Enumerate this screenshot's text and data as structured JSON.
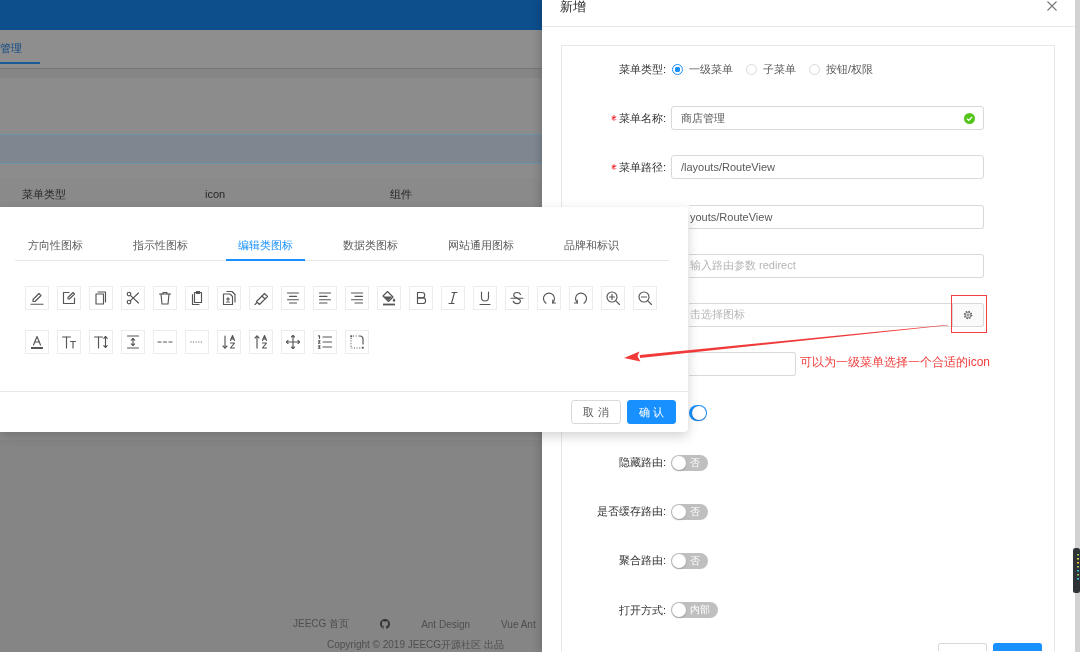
{
  "background": {
    "tab": {
      "label": "管理",
      "selected": true
    },
    "table_columns": [
      "菜单类型",
      "icon",
      "组件"
    ],
    "footer": {
      "links": [
        "JEECG 首页",
        "Ant Design",
        "Vue Ant"
      ],
      "copyright": "Copyright © 2019 JEECG开源社区 出品"
    }
  },
  "drawer": {
    "title": "新增",
    "form": [
      {
        "kind": "radio",
        "label": "菜单类型:",
        "required": false,
        "options": [
          {
            "label": "一级菜单",
            "selected": true
          },
          {
            "label": "子菜单",
            "selected": false
          },
          {
            "label": "按钮/权限",
            "selected": false
          }
        ]
      },
      {
        "kind": "input",
        "label": "菜单名称:",
        "required": true,
        "value": "商店管理",
        "valid": true
      },
      {
        "kind": "input",
        "label": "菜单路径:",
        "required": true,
        "value": "/layouts/RouteView",
        "valid": false
      },
      {
        "kind": "input",
        "value": "youts/RouteView"
      },
      {
        "kind": "input",
        "placeholder": "输入路由参数 redirect"
      },
      {
        "kind": "icon_input",
        "placeholder": "击选择图标"
      },
      {
        "kind": "number"
      },
      {
        "kind": "switch",
        "on": true
      },
      {
        "kind": "switch",
        "label": "隐藏路由:",
        "required": false,
        "on": false,
        "text": "否"
      },
      {
        "kind": "switch",
        "label": "是否缓存路由:",
        "required": false,
        "on": false,
        "text": "否"
      },
      {
        "kind": "switch",
        "label": "聚合路由:",
        "required": false,
        "on": false,
        "text": "否"
      },
      {
        "kind": "switch",
        "label": "打开方式:",
        "required": false,
        "on": false,
        "text": "内部"
      }
    ],
    "footer_buttons": [
      {
        "kind": "default"
      },
      {
        "kind": "primary"
      }
    ]
  },
  "icon_picker": {
    "tabs": [
      {
        "label": "方向性图标",
        "selected": false
      },
      {
        "label": "指示性图标",
        "selected": false
      },
      {
        "label": "编辑类图标",
        "selected": true
      },
      {
        "label": "数据类图标",
        "selected": false
      },
      {
        "label": "网站通用图标",
        "selected": false
      },
      {
        "label": "品牌和标识",
        "selected": false
      }
    ],
    "buttons": [
      {
        "label": "取 消",
        "kind": "default"
      },
      {
        "label": "确 认",
        "kind": "primary"
      }
    ]
  },
  "annotation": {
    "text": "可以为一级菜单选择一个合适的icon"
  }
}
